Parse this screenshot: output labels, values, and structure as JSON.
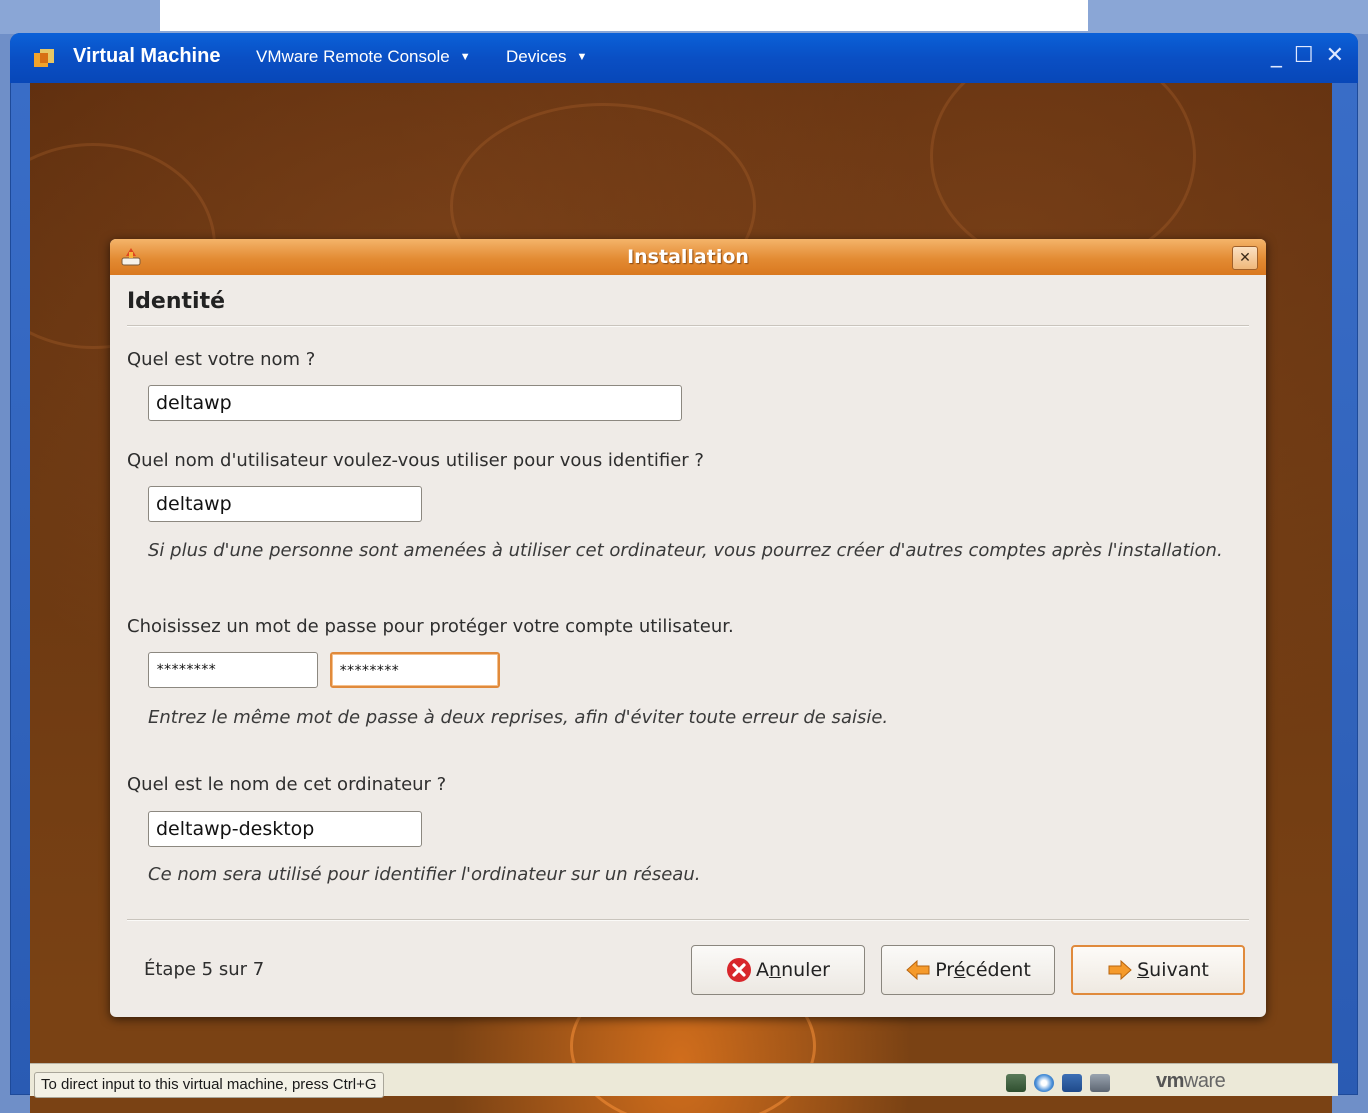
{
  "vm": {
    "title": "Virtual Machine",
    "menus": [
      {
        "label": "VMware Remote Console"
      },
      {
        "label": "Devices"
      }
    ],
    "controls": {
      "minimize": "_",
      "maximize": "☐",
      "close": "✕"
    }
  },
  "dialog": {
    "title": "Installation",
    "close_label": "✕",
    "heading": "Identité",
    "name_question": "Quel est votre nom ?",
    "name_value": "deltawp",
    "username_question": "Quel nom d'utilisateur voulez-vous utiliser pour vous identifier ?",
    "username_value": "deltawp",
    "username_hint": "Si plus d'une personne sont amenées à utiliser cet ordinateur, vous pourrez créer d'autres comptes après l'installation.",
    "password_question": "Choisissez un mot de passe pour protéger votre compte utilisateur.",
    "password_value": "********",
    "password_confirm_value": "********",
    "password_hint": "Entrez le même mot de passe à deux reprises, afin d'éviter toute erreur de saisie.",
    "computer_question": "Quel est le nom de cet ordinateur ?",
    "computer_value": "deltawp-desktop",
    "computer_hint": "Ce nom sera utilisé pour identifier l'ordinateur sur un réseau.",
    "step": "Étape 5 sur 7",
    "buttons": {
      "cancel_pre": "A",
      "cancel_ul": "n",
      "cancel_post": "nuler",
      "back_pre": "Pr",
      "back_ul": "é",
      "back_post": "cédent",
      "next_pre": "",
      "next_ul": "S",
      "next_post": "uivant"
    }
  },
  "statusbar": {
    "message": "To direct input to this virtual machine, press Ctrl+G",
    "logo_bold": "vm",
    "logo_rest": "ware"
  },
  "colors": {
    "accent": "#e08a3c",
    "vm_titlebar": "#0a4fc4",
    "dialog_bg": "#efebe7"
  },
  "icons": [
    "vm-app-icon",
    "installer-icon",
    "cancel-icon",
    "back-arrow-icon",
    "next-arrow-icon",
    "device-icons"
  ]
}
